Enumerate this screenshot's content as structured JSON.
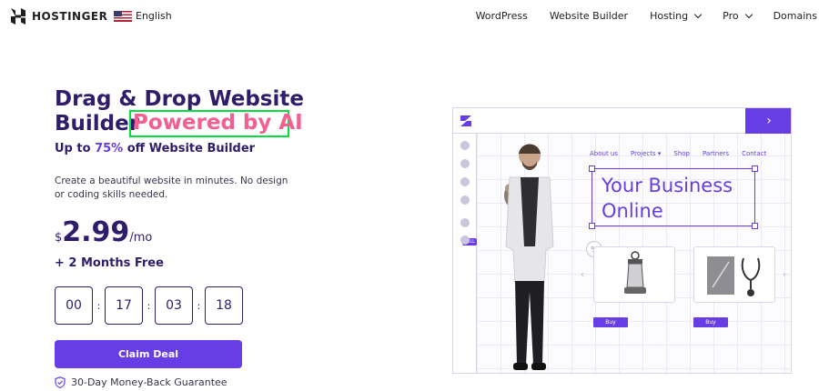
{
  "nav": {
    "brand": "HOSTINGER",
    "language": "English",
    "links": [
      {
        "label": "WordPress",
        "dropdown": false
      },
      {
        "label": "Website Builder",
        "dropdown": false
      },
      {
        "label": "Hosting",
        "dropdown": true
      },
      {
        "label": "Pro",
        "dropdown": true
      },
      {
        "label": "Domains",
        "dropdown": false
      }
    ]
  },
  "hero": {
    "title": "Drag & Drop Website Builder",
    "highlight": "Powered by AI",
    "subtitle_pre": "Up to ",
    "subtitle_pct": "75%",
    "subtitle_post": " off Website Builder",
    "description": "Create a beautiful website in minutes. No design or coding skills needed.",
    "price_currency": "$",
    "price_amount": "2.99",
    "price_period": "/mo",
    "bonus": "+ 2 Months Free",
    "timer": [
      "00",
      "17",
      "03",
      "18"
    ],
    "cta_label": "Claim Deal",
    "guarantee": "30-Day Money-Back Guarantee"
  },
  "preview": {
    "nav": [
      "About us",
      "Projects",
      "Shop",
      "Partners",
      "Contact"
    ],
    "headline_line1": "Your Business",
    "headline_line2": "Online",
    "badge": "SELL",
    "discount_symbol": "%",
    "buy_label": "Buy"
  },
  "colors": {
    "accent": "#673de6",
    "heading": "#2f1c6a",
    "highlight": "#f1608f",
    "highlight_box": "#00e23a"
  }
}
